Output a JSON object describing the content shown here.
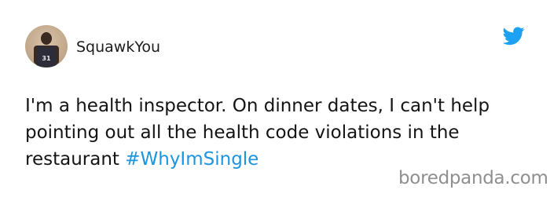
{
  "tweet": {
    "username": "SquawkYou",
    "text_lines": [
      "I'm a health inspector. On dinner dates, I can't help",
      "pointing out all the health code violations in the",
      "restaurant "
    ],
    "hashtag": "#WhyImSingle",
    "twitter_icon": "twitter-bird-icon",
    "avatar_jersey_number": "31",
    "colors": {
      "hashtag": "#1b95e0",
      "twitter_blue": "#1da1f2",
      "text": "#141414"
    }
  },
  "watermark": {
    "text": "boredpanda.com"
  }
}
